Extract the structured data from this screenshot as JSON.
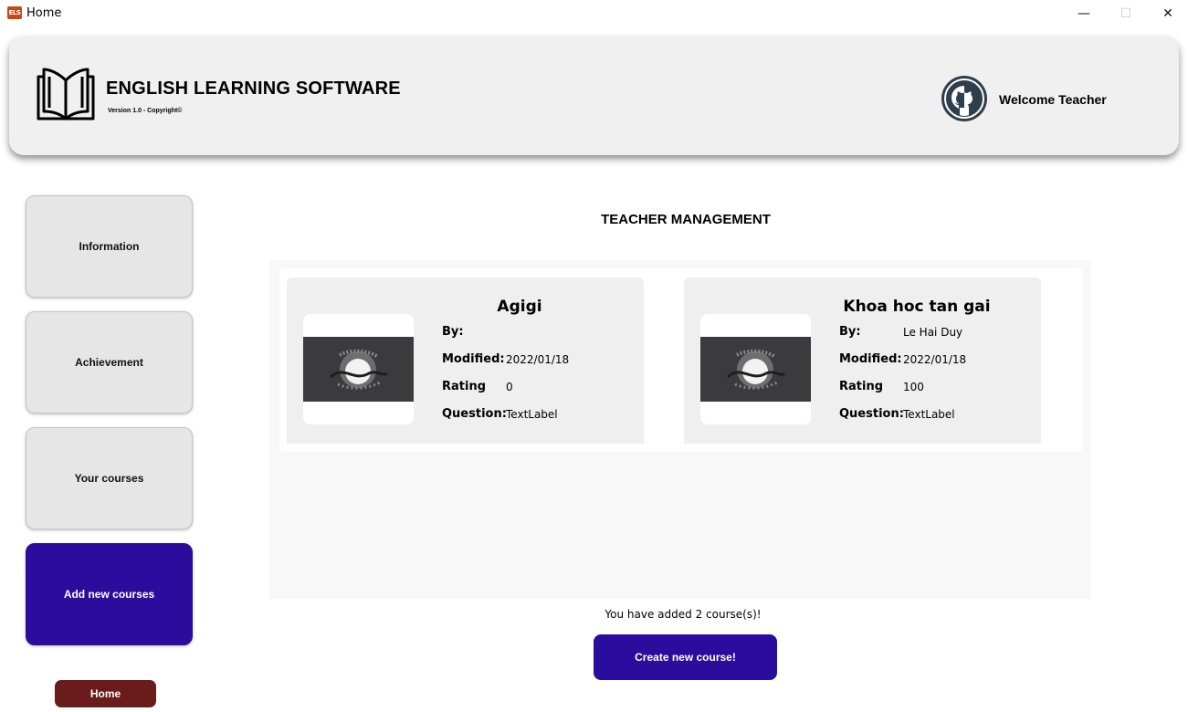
{
  "window": {
    "icon_text": "ELS",
    "title": "Home",
    "minimize": "—",
    "maximize": "☐",
    "close": "✕"
  },
  "header": {
    "app_name": "ENGLISH LEARNING SOFTWARE",
    "version": "Version 1.0 - Copyright©",
    "welcome": "Welcome Teacher"
  },
  "sidebar": {
    "items": [
      {
        "label": "Information"
      },
      {
        "label": "Achievement"
      },
      {
        "label": "Your courses"
      },
      {
        "label": "Add new courses",
        "active": true
      }
    ],
    "home_label": "Home"
  },
  "main": {
    "title": "TEACHER MANAGEMENT",
    "labels": {
      "by": "By:",
      "modified": "Modified:",
      "rating": "Rating",
      "question": "Question:"
    },
    "courses": [
      {
        "name": "Agigi",
        "by": "",
        "modified": "2022/01/18",
        "rating": "0",
        "question": "TextLabel"
      },
      {
        "name": "Khoa hoc tan gai",
        "by": "Le Hai Duy",
        "modified": "2022/01/18",
        "rating": "100",
        "question": "TextLabel"
      }
    ],
    "count_text": "You have added 2 course(s)!",
    "create_label": "Create new course!"
  },
  "colors": {
    "accent": "#2a0d9c",
    "home_button": "#6a1c1c",
    "header_bg": "#f0f0f0"
  }
}
